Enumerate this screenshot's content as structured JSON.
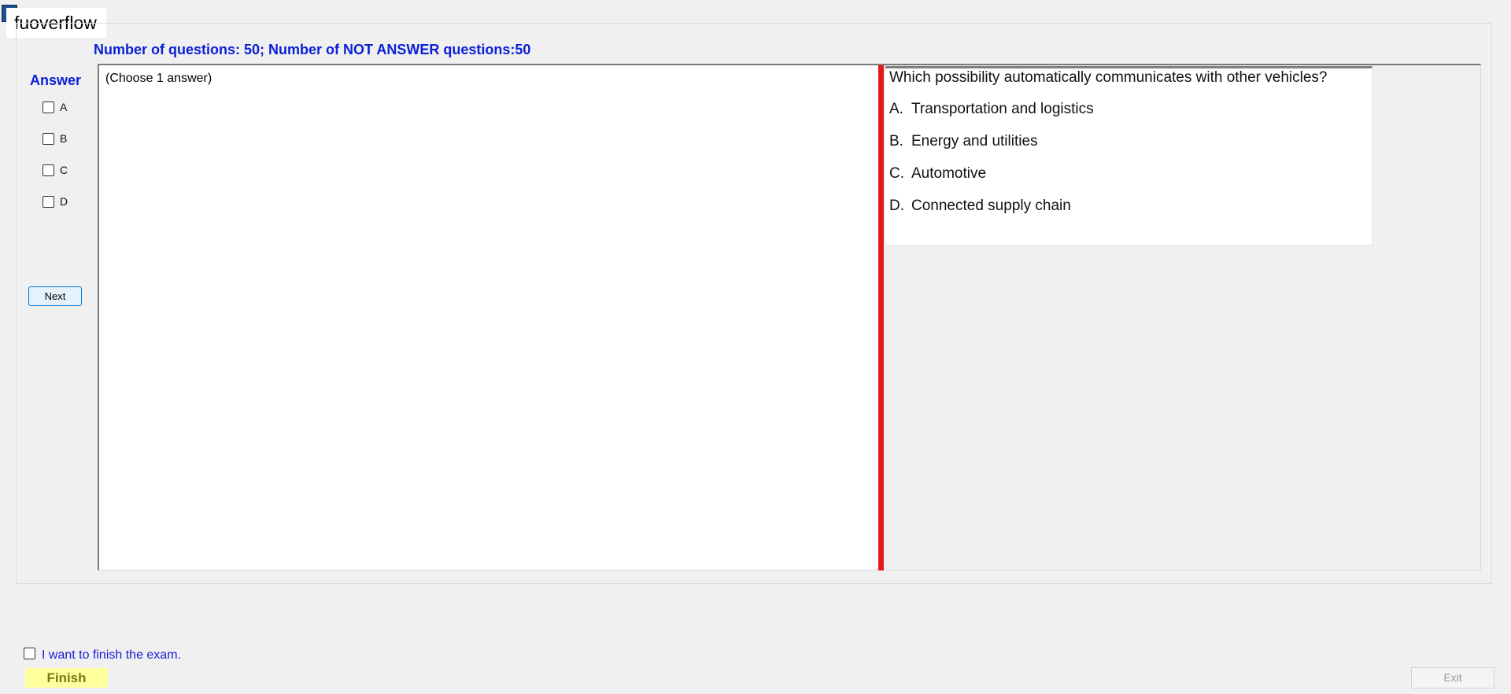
{
  "window": {
    "title": "fuoverflow"
  },
  "header": {
    "stats": "Number of questions: 50; Number of NOT ANSWER questions:50"
  },
  "answer_panel": {
    "title": "Answer",
    "options": [
      "A",
      "B",
      "C",
      "D"
    ],
    "next_label": "Next"
  },
  "left_pane": {
    "hint": "(Choose 1 answer)"
  },
  "question": {
    "text": "Which possibility automatically communicates with other vehicles?",
    "choices": [
      {
        "letter": "A.",
        "text": "Transportation and logistics"
      },
      {
        "letter": "B.",
        "text": "Energy and utilities"
      },
      {
        "letter": "C.",
        "text": "Automotive"
      },
      {
        "letter": "D.",
        "text": "Connected supply chain"
      }
    ]
  },
  "footer": {
    "finish_checkbox_label": "I want to finish the exam.",
    "finish_label": "Finish",
    "exit_label": "Exit"
  },
  "colors": {
    "accent_blue": "#0a1fd8",
    "splitter_red": "#e3191b",
    "finish_yellow": "#ffff9e"
  }
}
